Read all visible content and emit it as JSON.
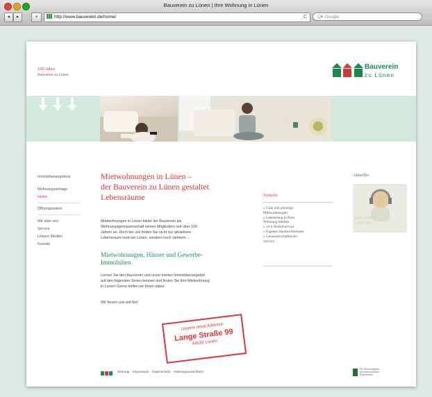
{
  "browser": {
    "window_title": "Bauverein zu Lünen | Ihre Wohnung in Lünen",
    "url": "http://www.bauverein.de/home/",
    "search_placeholder": "Q▾ Google",
    "back_icon": "◂",
    "forward_icon": "▸",
    "add_icon": "+",
    "reload_icon": "C"
  },
  "header": {
    "jubilee_title": "100 Jahre",
    "jubilee_subtitle": "Bauverein zu Lünen",
    "logo_line1": "Bauverein",
    "logo_line2": "zu Lünen",
    "brand_green": "#1a8a4a",
    "brand_red": "#d5373b"
  },
  "sidebar": {
    "items": [
      {
        "label": "Immobilienangebote",
        "active": false
      },
      {
        "label": "Wohnungsanfrage",
        "active": false
      },
      {
        "label": "Home",
        "active": true
      },
      {
        "label": "Öffnungszeiten",
        "active": false
      },
      {
        "label": "Wir über uns",
        "active": false
      },
      {
        "label": "Service",
        "active": false
      },
      {
        "label": "Unsere Medien",
        "active": false
      },
      {
        "label": "Kontakt",
        "active": false
      }
    ]
  },
  "main": {
    "heading_line1": "Mietwohnungen in Lünen –",
    "heading_line2": "der Bauverein zu Lünen gestaltet",
    "heading_line3": "Lebensräume",
    "intro_line1": "Mietwohnungen in Lünen bietet der Bauverein als",
    "intro_line2": "Wohnungsgenossenschaft seinen Mitgliedern seit über 100",
    "intro_line3": "Jahren an. Doch bei uns finden Sie nicht nur attraktiven",
    "intro_line4": "Lebensraum rund um Lünen, sondern noch vielmehr ...",
    "subheading_line1": "Mietwohnungen, Häuser und Gewerbe-",
    "subheading_line2": "Immobilien",
    "body_line1": "Lernen Sie den Bauverein und unser breites Immobilienangebot",
    "body_line2": "auf den folgenden Seiten kennen und finden Sie Ihre Mietwohnung",
    "body_line3": "in Lünen! Gerne helfen wir Ihnen dabei.",
    "closing": "Wir freuen uns auf Sie!"
  },
  "vorteile": {
    "title": "Vorteile",
    "items": [
      "» Gute und günstige",
      "   Mietwohnungen",
      "» Lebenslang in Ihrer",
      "   Wohnung bleiben",
      "» 24 h Notfallservice",
      "» Eigenes Handwerkerteam",
      "» Genossenschaftlicher",
      "   Service"
    ]
  },
  "aktuelles": {
    "title": "Aktuelles",
    "caption_line1": "Maß erzählen!",
    "caption_line2": "» Infospots"
  },
  "stamp": {
    "line1": "Unsere neue Adresse:",
    "line2": "Lange Straße 99",
    "line3": "44532 Lünen"
  },
  "footer": {
    "links": [
      "Sitemap",
      "Impressum",
      "Datenschutz",
      "Haftungsausschluss"
    ],
    "badge_line1": "Die Wohnungsbau-",
    "badge_line2": "genossenschaften",
    "badge_line3": "Deutschland"
  }
}
